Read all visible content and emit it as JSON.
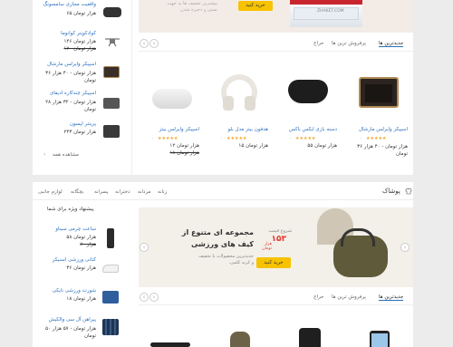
{
  "sidebar1": {
    "items": [
      {
        "name": "واقعیت مجازی سامسونگ",
        "price": "۶۵ هزار تومان",
        "old": "",
        "icon": "vr-headset-icon"
      },
      {
        "name": "کوادکوپتر کوانوما",
        "price": "۱۴۶ هزار تومان",
        "old": "۱۷۰ هزار تومان",
        "icon": "drone-icon"
      },
      {
        "name": "اسپیکر وایرلس مارشال",
        "price": "۳۶ هزار تومان - ۴۰ هزار تومان",
        "old": "",
        "icon": "speaker-icon"
      },
      {
        "name": "اسپیکر چندکاره ادیفای",
        "price": "۲۸ هزار تومان - ۳۲ هزار تومان",
        "old": "",
        "icon": "speaker-icon"
      },
      {
        "name": "پرینتر اپسون",
        "price": "۲۴۳ هزار تومان",
        "old": "",
        "icon": "printer-icon"
      }
    ],
    "view_all": "مشاهده همه"
  },
  "banner1": {
    "text1": "بیشترین تخفیف ها به جهت",
    "text2": "بستن و ذخیره شدن",
    "button": "خرید کنید",
    "brand": "ZHAKET.COM"
  },
  "tabs1": [
    "جدیدترین ها",
    "پرفروش ترین ها",
    "حراج"
  ],
  "products1": [
    {
      "name": "اسپیکر وایرلس مارشال",
      "price": "۳۶ هزار تومان - ۴۰ هزار تومان",
      "old": "",
      "stars": "★★★★★",
      "count": "۰"
    },
    {
      "name": "دسته بازی ایکس باکس",
      "price": "۵۵ هزار تومان",
      "old": "",
      "stars": "★★★★★",
      "count": "۰"
    },
    {
      "name": "هدفون بیتز مدل بلو",
      "price": "۱۵ هزار تومان",
      "old": "",
      "stars": "★★★★★",
      "count": "۰"
    },
    {
      "name": "اسپیکر وایرلس بیتز",
      "price": "۱۲ هزار تومان",
      "old": "۱۸ هزار تومان",
      "stars": "★★★★★",
      "count": "۰"
    }
  ],
  "section2": {
    "title": "پوشاک",
    "nav": [
      "زنانه",
      "مردانه",
      "دخترانه",
      "پسرانه",
      "بچگانه",
      "لوازم جانبی"
    ],
    "special_title": "پیشنهاد ویژه برای شما",
    "banner": {
      "line1": "مجموعه ای متنوع از",
      "line2": "کیف های ورزشی",
      "desc1": "جدیدترین محصولات با تخفیف",
      "desc2": "و کرنه کلمی.",
      "price_label": "شروع قیمت",
      "price": "۱۵۳",
      "unit": "هزار تومان",
      "button": "خرید کنید"
    },
    "tabs": [
      "جدیدترین ها",
      "پرفروش ترین ها",
      "حراج"
    ],
    "items": [
      {
        "name": "ساعت چرمی سیناو",
        "price": "۵۸ هزار تومان",
        "old": "۷۰ هزار",
        "icon": "watch-icon"
      },
      {
        "name": "کتانی ورزشی اسنیکر",
        "price": "۳۶ هزار تومان",
        "old": "",
        "icon": "sneaker-icon"
      },
      {
        "name": "شورت ورزشی نایکی",
        "price": "۱۸ هزار تومان",
        "old": "",
        "icon": "shorts-icon"
      },
      {
        "name": "پیراهن آل سی والکیش",
        "price": "۵۰ هزار تومان - ۵۷ هزار تومان",
        "old": "",
        "icon": "shirt-icon"
      }
    ]
  },
  "colors": {
    "accent": "#f7c200",
    "link": "#2a6fbf",
    "sale": "#e53935"
  }
}
